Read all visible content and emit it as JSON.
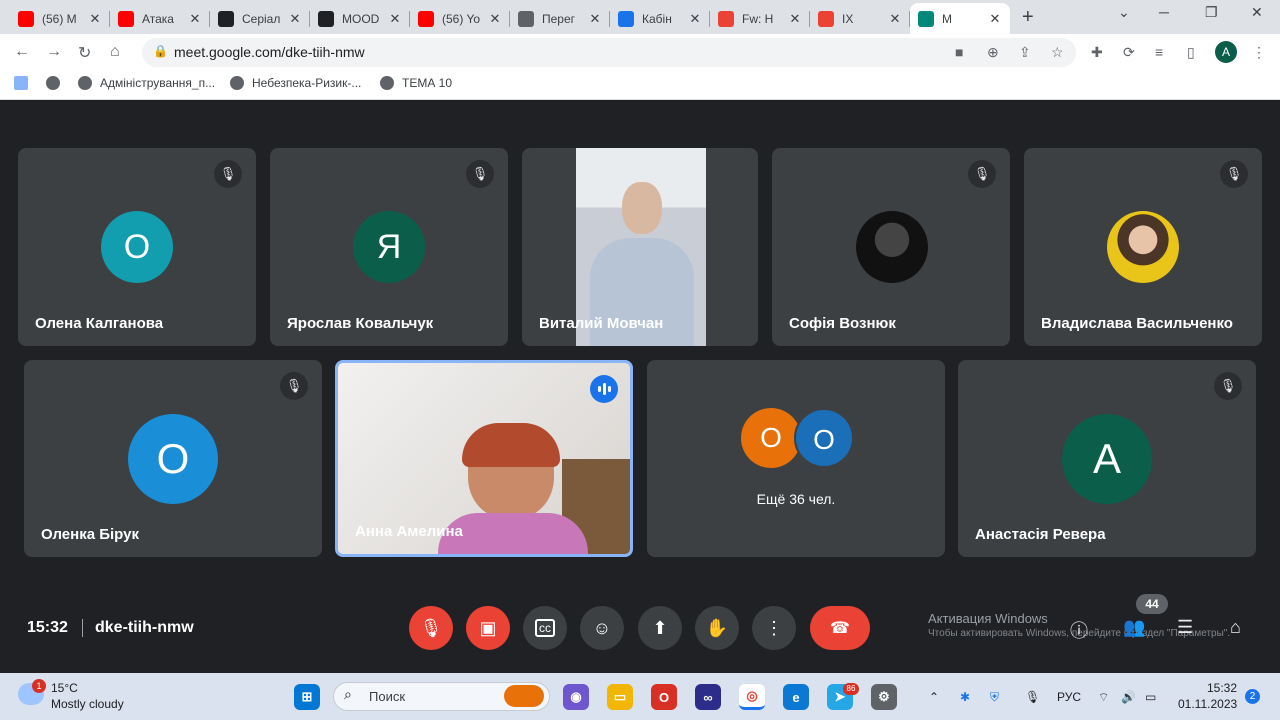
{
  "browser": {
    "tabs": [
      {
        "title": "(56) M",
        "favicon": "youtube-icon",
        "color": "#ff0000"
      },
      {
        "title": "Атака",
        "favicon": "youtube-icon",
        "color": "#ff0000"
      },
      {
        "title": "Серіал",
        "favicon": "film-icon",
        "color": "#202124"
      },
      {
        "title": "MOOD",
        "favicon": "m-icon",
        "color": "#202124"
      },
      {
        "title": "(56) Yo",
        "favicon": "youtube-icon",
        "color": "#ff0000"
      },
      {
        "title": "Перег",
        "favicon": "face-icon",
        "color": "#5f6368"
      },
      {
        "title": "Кабін",
        "favicon": "cabinet-icon",
        "color": "#1a73e8"
      },
      {
        "title": "Fw: Н",
        "favicon": "gmail-icon",
        "color": "#ea4335"
      },
      {
        "title": "IX",
        "favicon": "arrow-icon",
        "color": "#ea4335"
      },
      {
        "title": "M",
        "favicon": "meet-icon",
        "color": "#00897b",
        "active": true
      }
    ],
    "new_tab": "+",
    "url": "meet.google.com/dke-tiih-nmw",
    "profile_letter": "A",
    "bookmarks": [
      "Адміністрування_п...",
      "Небезпека-Ризик-...",
      "ТЕМА 10"
    ]
  },
  "meet": {
    "participants_row1": [
      {
        "name": "Олена Калганова",
        "letter": "О",
        "color": "#129eaf",
        "muted": true,
        "kind": "letter"
      },
      {
        "name": "Ярослав Ковальчук",
        "letter": "Я",
        "color": "#0b5e4a",
        "muted": true,
        "kind": "letter"
      },
      {
        "name": "Виталий Мовчан",
        "kind": "video",
        "muted": false
      },
      {
        "name": "Софія Вознюк",
        "kind": "photo",
        "muted": true
      },
      {
        "name": "Владислава Васильченко",
        "kind": "photo",
        "muted": true
      }
    ],
    "participants_row2": [
      {
        "name": "Оленка Бірук",
        "letter": "О",
        "color": "#1a8fd8",
        "muted": true,
        "kind": "letter"
      },
      {
        "name": "Анна Амелина",
        "kind": "video",
        "speaking": true
      },
      {
        "name": "",
        "kind": "more",
        "letters": [
          "О",
          "О"
        ],
        "colors": [
          "#e8710a",
          "#1a6fb8"
        ],
        "more_label": "Ещё 36 чел."
      },
      {
        "name": "Анастасія Ревера",
        "letter": "А",
        "color": "#0b5e4a",
        "muted": true,
        "kind": "letter"
      }
    ],
    "time": "15:32",
    "meeting_code": "dke-tiih-nmw",
    "participant_count": "44",
    "activation_title": "Активация Windows",
    "activation_sub": "Чтобы активировать Windows, перейдите в раздел \"Параметры\"."
  },
  "taskbar": {
    "weather_temp": "15°C",
    "weather_desc": "Mostly cloudy",
    "weather_badge": "1",
    "search_placeholder": "Поиск",
    "telegram_badge": "86",
    "lang": "РУС",
    "clock_time": "15:32",
    "clock_date": "01.11.2023",
    "notif_count": "2"
  }
}
